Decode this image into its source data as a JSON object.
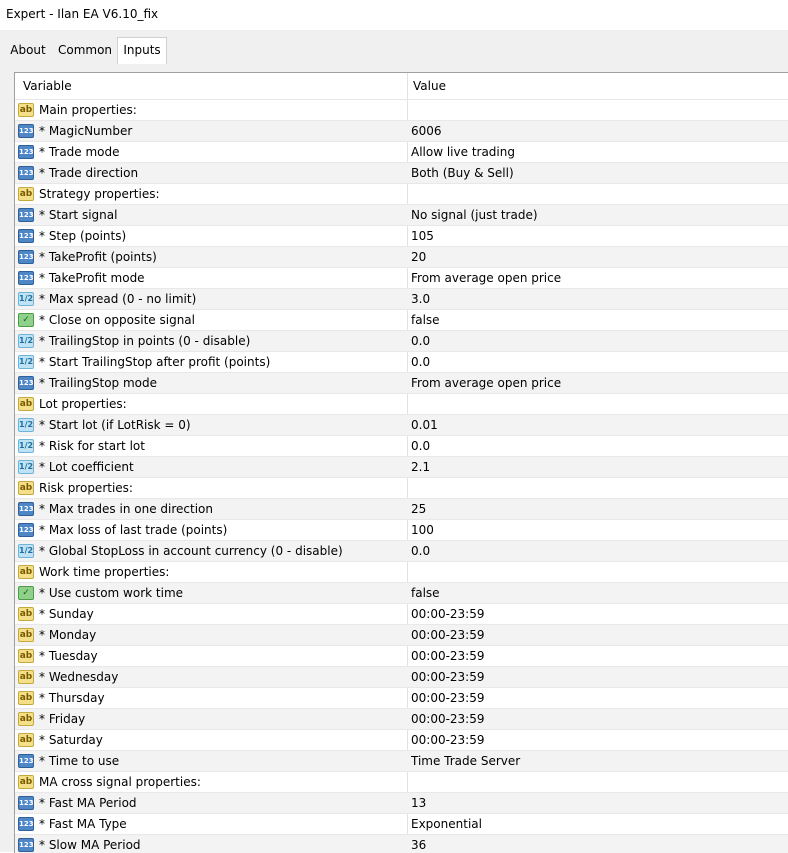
{
  "window": {
    "title": "Expert - Ilan EA V6.10_fix"
  },
  "tabs": [
    "About",
    "Common",
    "Inputs"
  ],
  "grid": {
    "headers": {
      "variable": "Variable",
      "value": "Value"
    },
    "rows": [
      {
        "icon": "ab",
        "variable": "Main properties:",
        "value": ""
      },
      {
        "icon": "num",
        "variable": "* MagicNumber",
        "value": "6006"
      },
      {
        "icon": "num",
        "variable": "* Trade mode",
        "value": "Allow live trading"
      },
      {
        "icon": "num",
        "variable": "* Trade direction",
        "value": "Both (Buy & Sell)"
      },
      {
        "icon": "ab",
        "variable": "Strategy properties:",
        "value": ""
      },
      {
        "icon": "num",
        "variable": "* Start signal",
        "value": "No signal (just trade)"
      },
      {
        "icon": "num",
        "variable": "* Step (points)",
        "value": "105"
      },
      {
        "icon": "num",
        "variable": "* TakeProfit (points)",
        "value": "20"
      },
      {
        "icon": "num",
        "variable": "* TakeProfit mode",
        "value": "From average open price"
      },
      {
        "icon": "dbl",
        "variable": "* Max spread (0 - no limit)",
        "value": "3.0"
      },
      {
        "icon": "bool",
        "variable": "* Close on opposite signal",
        "value": "false"
      },
      {
        "icon": "dbl",
        "variable": "* TrailingStop in points (0 - disable)",
        "value": "0.0"
      },
      {
        "icon": "dbl",
        "variable": "* Start TrailingStop after profit (points)",
        "value": "0.0"
      },
      {
        "icon": "num",
        "variable": "* TrailingStop mode",
        "value": "From average open price"
      },
      {
        "icon": "ab",
        "variable": "Lot properties:",
        "value": ""
      },
      {
        "icon": "dbl",
        "variable": "* Start lot (if LotRisk = 0)",
        "value": "0.01"
      },
      {
        "icon": "dbl",
        "variable": "* Risk for start lot",
        "value": "0.0"
      },
      {
        "icon": "dbl",
        "variable": "* Lot coefficient",
        "value": "2.1"
      },
      {
        "icon": "ab",
        "variable": "Risk properties:",
        "value": ""
      },
      {
        "icon": "num",
        "variable": "* Max trades in one direction",
        "value": "25"
      },
      {
        "icon": "num",
        "variable": "* Max loss of last trade (points)",
        "value": "100"
      },
      {
        "icon": "dbl",
        "variable": "* Global StopLoss in account currency (0 - disable)",
        "value": "0.0"
      },
      {
        "icon": "ab",
        "variable": "Work time properties:",
        "value": ""
      },
      {
        "icon": "bool",
        "variable": "* Use custom work time",
        "value": "false"
      },
      {
        "icon": "ab",
        "variable": "* Sunday",
        "value": "00:00-23:59"
      },
      {
        "icon": "ab",
        "variable": "* Monday",
        "value": "00:00-23:59"
      },
      {
        "icon": "ab",
        "variable": "* Tuesday",
        "value": "00:00-23:59"
      },
      {
        "icon": "ab",
        "variable": "* Wednesday",
        "value": "00:00-23:59"
      },
      {
        "icon": "ab",
        "variable": "* Thursday",
        "value": "00:00-23:59"
      },
      {
        "icon": "ab",
        "variable": "* Friday",
        "value": "00:00-23:59"
      },
      {
        "icon": "ab",
        "variable": "* Saturday",
        "value": "00:00-23:59"
      },
      {
        "icon": "num",
        "variable": "* Time to use",
        "value": "Time Trade Server"
      },
      {
        "icon": "ab",
        "variable": "MA cross signal properties:",
        "value": ""
      },
      {
        "icon": "num",
        "variable": "* Fast MA Period",
        "value": "13"
      },
      {
        "icon": "num",
        "variable": "* Fast MA Type",
        "value": "Exponential"
      },
      {
        "icon": "num",
        "variable": "* Slow MA Period",
        "value": "36"
      }
    ]
  },
  "icon_glyphs": {
    "ab": "ab",
    "num": "123",
    "dbl": "1/2",
    "bool": "✓"
  }
}
